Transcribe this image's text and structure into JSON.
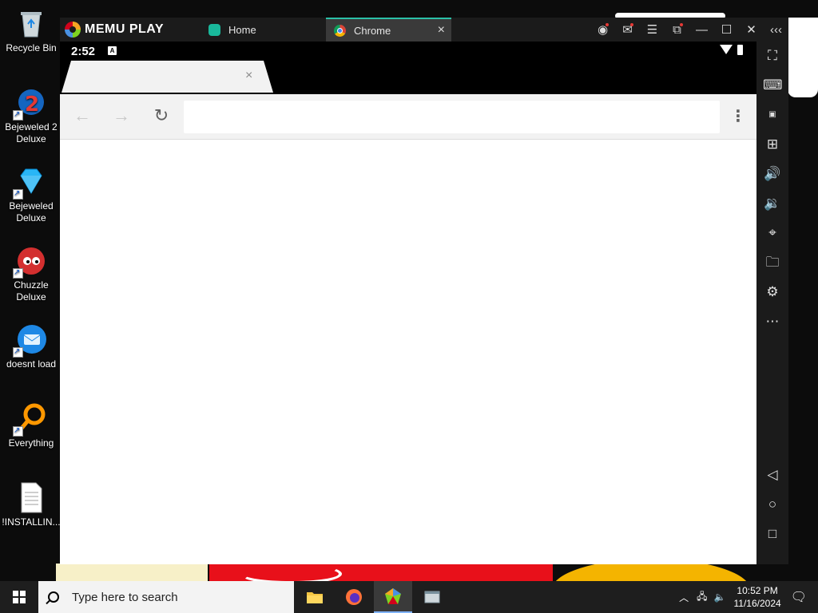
{
  "desktop": {
    "icons": [
      {
        "label": "Recycle Bin"
      },
      {
        "label": "Bejeweled 2 Deluxe"
      },
      {
        "label": "Bejeweled Deluxe"
      },
      {
        "label": "Chuzzle Deluxe"
      },
      {
        "label": "doesnt load"
      },
      {
        "label": "Everything"
      },
      {
        "label": "!INSTALLIN..."
      }
    ]
  },
  "emulator": {
    "brand": "MEMU PLAY",
    "tabs": [
      {
        "label": "Home"
      },
      {
        "label": "Chrome",
        "close": "×"
      }
    ],
    "accent_color": "#2bc1a8"
  },
  "android": {
    "status_time": "2:52",
    "status_indicator": "A",
    "chrome": {
      "tab_close": "×",
      "back": "←",
      "forward": "→",
      "reload": "↻",
      "omnibox_value": "",
      "menu": "⋮"
    }
  },
  "taskbar": {
    "search_placeholder": "Type here to search",
    "time": "10:52 PM",
    "date": "11/16/2024"
  }
}
